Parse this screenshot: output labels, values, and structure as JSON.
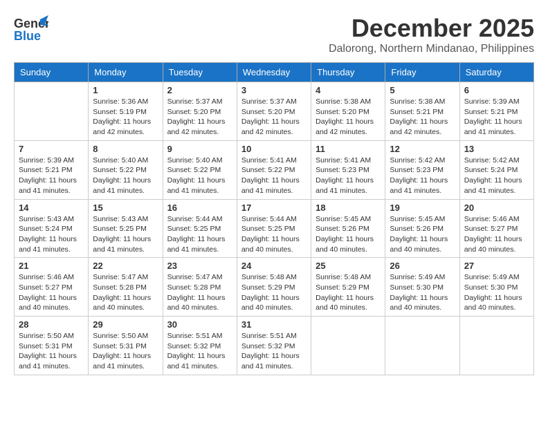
{
  "header": {
    "logo_general": "General",
    "logo_blue": "Blue",
    "month_title": "December 2025",
    "subtitle": "Dalorong, Northern Mindanao, Philippines"
  },
  "weekdays": [
    "Sunday",
    "Monday",
    "Tuesday",
    "Wednesday",
    "Thursday",
    "Friday",
    "Saturday"
  ],
  "weeks": [
    [
      {
        "day": "",
        "sunrise": "",
        "sunset": "",
        "daylight": ""
      },
      {
        "day": "1",
        "sunrise": "Sunrise: 5:36 AM",
        "sunset": "Sunset: 5:19 PM",
        "daylight": "Daylight: 11 hours and 42 minutes."
      },
      {
        "day": "2",
        "sunrise": "Sunrise: 5:37 AM",
        "sunset": "Sunset: 5:20 PM",
        "daylight": "Daylight: 11 hours and 42 minutes."
      },
      {
        "day": "3",
        "sunrise": "Sunrise: 5:37 AM",
        "sunset": "Sunset: 5:20 PM",
        "daylight": "Daylight: 11 hours and 42 minutes."
      },
      {
        "day": "4",
        "sunrise": "Sunrise: 5:38 AM",
        "sunset": "Sunset: 5:20 PM",
        "daylight": "Daylight: 11 hours and 42 minutes."
      },
      {
        "day": "5",
        "sunrise": "Sunrise: 5:38 AM",
        "sunset": "Sunset: 5:21 PM",
        "daylight": "Daylight: 11 hours and 42 minutes."
      },
      {
        "day": "6",
        "sunrise": "Sunrise: 5:39 AM",
        "sunset": "Sunset: 5:21 PM",
        "daylight": "Daylight: 11 hours and 41 minutes."
      }
    ],
    [
      {
        "day": "7",
        "sunrise": "Sunrise: 5:39 AM",
        "sunset": "Sunset: 5:21 PM",
        "daylight": "Daylight: 11 hours and 41 minutes."
      },
      {
        "day": "8",
        "sunrise": "Sunrise: 5:40 AM",
        "sunset": "Sunset: 5:22 PM",
        "daylight": "Daylight: 11 hours and 41 minutes."
      },
      {
        "day": "9",
        "sunrise": "Sunrise: 5:40 AM",
        "sunset": "Sunset: 5:22 PM",
        "daylight": "Daylight: 11 hours and 41 minutes."
      },
      {
        "day": "10",
        "sunrise": "Sunrise: 5:41 AM",
        "sunset": "Sunset: 5:22 PM",
        "daylight": "Daylight: 11 hours and 41 minutes."
      },
      {
        "day": "11",
        "sunrise": "Sunrise: 5:41 AM",
        "sunset": "Sunset: 5:23 PM",
        "daylight": "Daylight: 11 hours and 41 minutes."
      },
      {
        "day": "12",
        "sunrise": "Sunrise: 5:42 AM",
        "sunset": "Sunset: 5:23 PM",
        "daylight": "Daylight: 11 hours and 41 minutes."
      },
      {
        "day": "13",
        "sunrise": "Sunrise: 5:42 AM",
        "sunset": "Sunset: 5:24 PM",
        "daylight": "Daylight: 11 hours and 41 minutes."
      }
    ],
    [
      {
        "day": "14",
        "sunrise": "Sunrise: 5:43 AM",
        "sunset": "Sunset: 5:24 PM",
        "daylight": "Daylight: 11 hours and 41 minutes."
      },
      {
        "day": "15",
        "sunrise": "Sunrise: 5:43 AM",
        "sunset": "Sunset: 5:25 PM",
        "daylight": "Daylight: 11 hours and 41 minutes."
      },
      {
        "day": "16",
        "sunrise": "Sunrise: 5:44 AM",
        "sunset": "Sunset: 5:25 PM",
        "daylight": "Daylight: 11 hours and 41 minutes."
      },
      {
        "day": "17",
        "sunrise": "Sunrise: 5:44 AM",
        "sunset": "Sunset: 5:25 PM",
        "daylight": "Daylight: 11 hours and 40 minutes."
      },
      {
        "day": "18",
        "sunrise": "Sunrise: 5:45 AM",
        "sunset": "Sunset: 5:26 PM",
        "daylight": "Daylight: 11 hours and 40 minutes."
      },
      {
        "day": "19",
        "sunrise": "Sunrise: 5:45 AM",
        "sunset": "Sunset: 5:26 PM",
        "daylight": "Daylight: 11 hours and 40 minutes."
      },
      {
        "day": "20",
        "sunrise": "Sunrise: 5:46 AM",
        "sunset": "Sunset: 5:27 PM",
        "daylight": "Daylight: 11 hours and 40 minutes."
      }
    ],
    [
      {
        "day": "21",
        "sunrise": "Sunrise: 5:46 AM",
        "sunset": "Sunset: 5:27 PM",
        "daylight": "Daylight: 11 hours and 40 minutes."
      },
      {
        "day": "22",
        "sunrise": "Sunrise: 5:47 AM",
        "sunset": "Sunset: 5:28 PM",
        "daylight": "Daylight: 11 hours and 40 minutes."
      },
      {
        "day": "23",
        "sunrise": "Sunrise: 5:47 AM",
        "sunset": "Sunset: 5:28 PM",
        "daylight": "Daylight: 11 hours and 40 minutes."
      },
      {
        "day": "24",
        "sunrise": "Sunrise: 5:48 AM",
        "sunset": "Sunset: 5:29 PM",
        "daylight": "Daylight: 11 hours and 40 minutes."
      },
      {
        "day": "25",
        "sunrise": "Sunrise: 5:48 AM",
        "sunset": "Sunset: 5:29 PM",
        "daylight": "Daylight: 11 hours and 40 minutes."
      },
      {
        "day": "26",
        "sunrise": "Sunrise: 5:49 AM",
        "sunset": "Sunset: 5:30 PM",
        "daylight": "Daylight: 11 hours and 40 minutes."
      },
      {
        "day": "27",
        "sunrise": "Sunrise: 5:49 AM",
        "sunset": "Sunset: 5:30 PM",
        "daylight": "Daylight: 11 hours and 40 minutes."
      }
    ],
    [
      {
        "day": "28",
        "sunrise": "Sunrise: 5:50 AM",
        "sunset": "Sunset: 5:31 PM",
        "daylight": "Daylight: 11 hours and 41 minutes."
      },
      {
        "day": "29",
        "sunrise": "Sunrise: 5:50 AM",
        "sunset": "Sunset: 5:31 PM",
        "daylight": "Daylight: 11 hours and 41 minutes."
      },
      {
        "day": "30",
        "sunrise": "Sunrise: 5:51 AM",
        "sunset": "Sunset: 5:32 PM",
        "daylight": "Daylight: 11 hours and 41 minutes."
      },
      {
        "day": "31",
        "sunrise": "Sunrise: 5:51 AM",
        "sunset": "Sunset: 5:32 PM",
        "daylight": "Daylight: 11 hours and 41 minutes."
      },
      {
        "day": "",
        "sunrise": "",
        "sunset": "",
        "daylight": ""
      },
      {
        "day": "",
        "sunrise": "",
        "sunset": "",
        "daylight": ""
      },
      {
        "day": "",
        "sunrise": "",
        "sunset": "",
        "daylight": ""
      }
    ]
  ]
}
